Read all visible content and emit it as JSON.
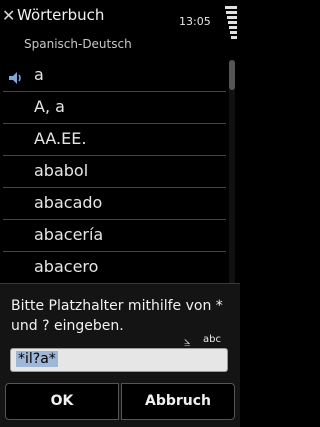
{
  "header": {
    "title": "Wörterbuch",
    "subtitle": "Spanisch-Deutsch",
    "time": "13:05"
  },
  "list": {
    "items": [
      {
        "label": "a",
        "speaker": true
      },
      {
        "label": "A, a"
      },
      {
        "label": "AA.EE."
      },
      {
        "label": "ababol"
      },
      {
        "label": "abacado"
      },
      {
        "label": "abacería"
      },
      {
        "label": "abacero"
      }
    ]
  },
  "dialog": {
    "prompt": "Bitte Platzhalter mithilfe von * und ? eingeben.",
    "input_mode": "abc",
    "input_value": "*il?a*",
    "ok_label": "OK",
    "cancel_label": "Abbruch"
  },
  "colors": {
    "background": "#000000",
    "dialog_bg": "#141414",
    "selection": "#9fb7d6"
  }
}
